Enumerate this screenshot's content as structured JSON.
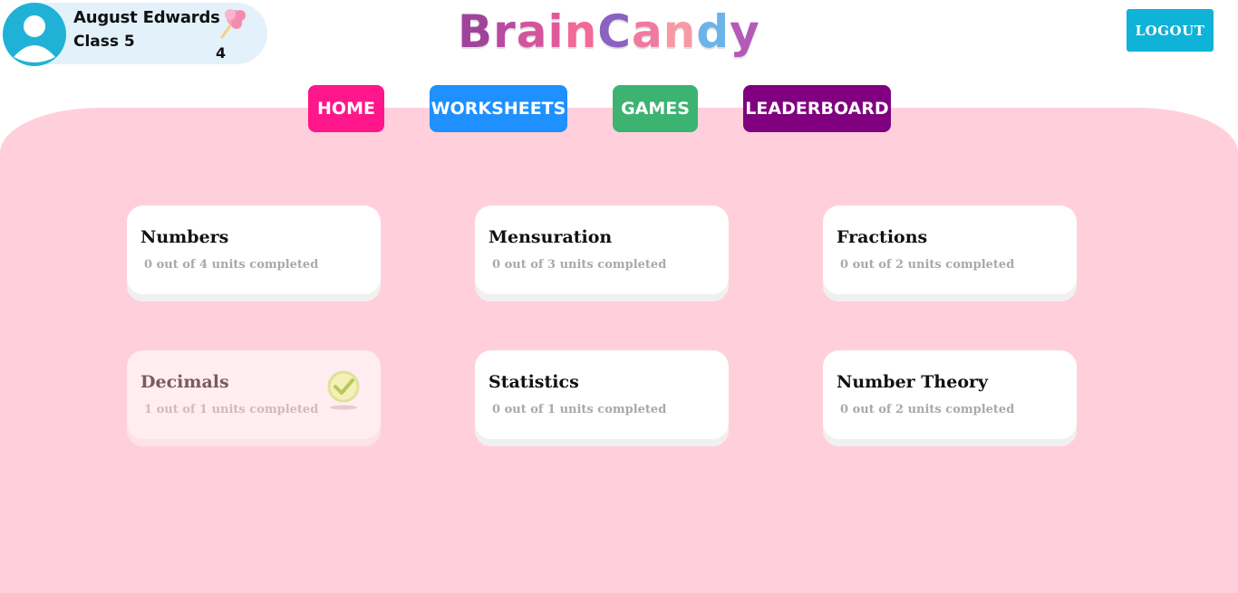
{
  "user": {
    "name": "August Edwards",
    "class": "Class 5",
    "candy_count": "4",
    "avatar_icon": "user-avatar-icon",
    "candy_icon": "cotton-candy-icon"
  },
  "logo": {
    "letters": [
      "B",
      "r",
      "a",
      "i",
      "n",
      "C",
      "a",
      "n",
      "d",
      "y"
    ],
    "colors": [
      "#a0449a",
      "#b94aa0",
      "#d3559e",
      "#e05a9b",
      "#f2699a",
      "#8a62c2",
      "#f07aa0",
      "#f79aa6",
      "#6cb3ea",
      "#b45ab8"
    ]
  },
  "header": {
    "logout_label": "LOGOUT"
  },
  "nav": {
    "home": "HOME",
    "worksheets": "WORKSHEETS",
    "games": "GAMES",
    "leaderboard": "LEADERBOARD"
  },
  "colors": {
    "home": "#ff168a",
    "worksheets": "#1e90ff",
    "games": "#3cb371",
    "leaderboard": "#800080",
    "logout": "#0fb3d8",
    "content_bg": "#ffd0db"
  },
  "topics": [
    {
      "title": "Numbers",
      "progress": "0 out of 4 units completed",
      "completed": false
    },
    {
      "title": "Mensuration",
      "progress": "0 out of 3 units completed",
      "completed": false
    },
    {
      "title": "Fractions",
      "progress": "0 out of 2 units completed",
      "completed": false
    },
    {
      "title": "Decimals",
      "progress": "1 out of 1 units completed",
      "completed": true,
      "icon": "check-circle-icon"
    },
    {
      "title": "Statistics",
      "progress": "0 out of 1 units completed",
      "completed": false
    },
    {
      "title": "Number Theory",
      "progress": "0 out of 2 units completed",
      "completed": false
    }
  ]
}
